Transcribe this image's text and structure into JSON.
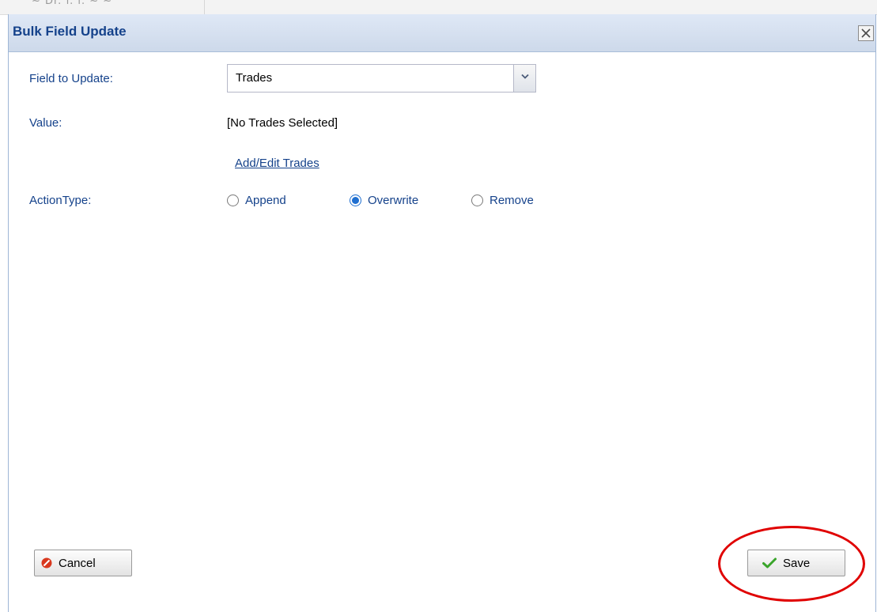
{
  "background": {
    "ghost_text": "~ Dr. f. i. ~ ~"
  },
  "dialog": {
    "title": "Bulk Field Update",
    "close_label": "×"
  },
  "form": {
    "field_to_update_label": "Field to Update:",
    "field_to_update_value": "Trades",
    "value_label": "Value:",
    "value_text": "[No Trades Selected]",
    "add_edit_link": "Add/Edit Trades",
    "action_type_label": "ActionType:",
    "action_options": [
      {
        "label": "Append",
        "checked": false
      },
      {
        "label": "Overwrite",
        "checked": true
      },
      {
        "label": "Remove",
        "checked": false
      }
    ]
  },
  "buttons": {
    "cancel_label": "Cancel",
    "save_label": "Save"
  },
  "colors": {
    "label_blue": "#15428b",
    "highlight_red": "#e00000",
    "save_check_green": "#3aa52b",
    "cancel_icon_red": "#d9381e"
  }
}
